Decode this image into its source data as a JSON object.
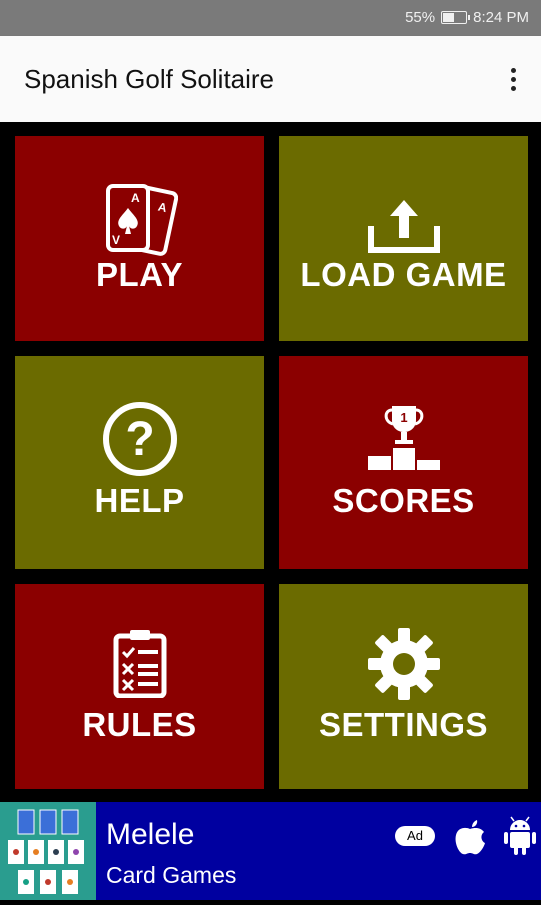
{
  "status_bar": {
    "battery_percent": "55%",
    "time": "8:24 PM",
    "icons": [
      "battery-icon"
    ]
  },
  "app_bar": {
    "title": "Spanish Golf Solitaire",
    "menu_icon": "overflow-menu-icon"
  },
  "menu": {
    "tiles": [
      {
        "label": "PLAY",
        "icon": "playing-cards-icon",
        "color": "#8b0000"
      },
      {
        "label": "LOAD GAME",
        "icon": "upload-icon",
        "color": "#6b6b00"
      },
      {
        "label": "HELP",
        "icon": "question-circle-icon",
        "color": "#6b6b00"
      },
      {
        "label": "SCORES",
        "icon": "trophy-podium-icon",
        "color": "#8b0000"
      },
      {
        "label": "RULES",
        "icon": "clipboard-checklist-icon",
        "color": "#8b0000"
      },
      {
        "label": "SETTINGS",
        "icon": "gear-icon",
        "color": "#6b6b00"
      }
    ]
  },
  "ad": {
    "title": "Melele",
    "subtitle": "Card Games",
    "badge": "Ad",
    "background": "#0000a0",
    "icons": [
      "apple-icon",
      "android-icon"
    ]
  }
}
